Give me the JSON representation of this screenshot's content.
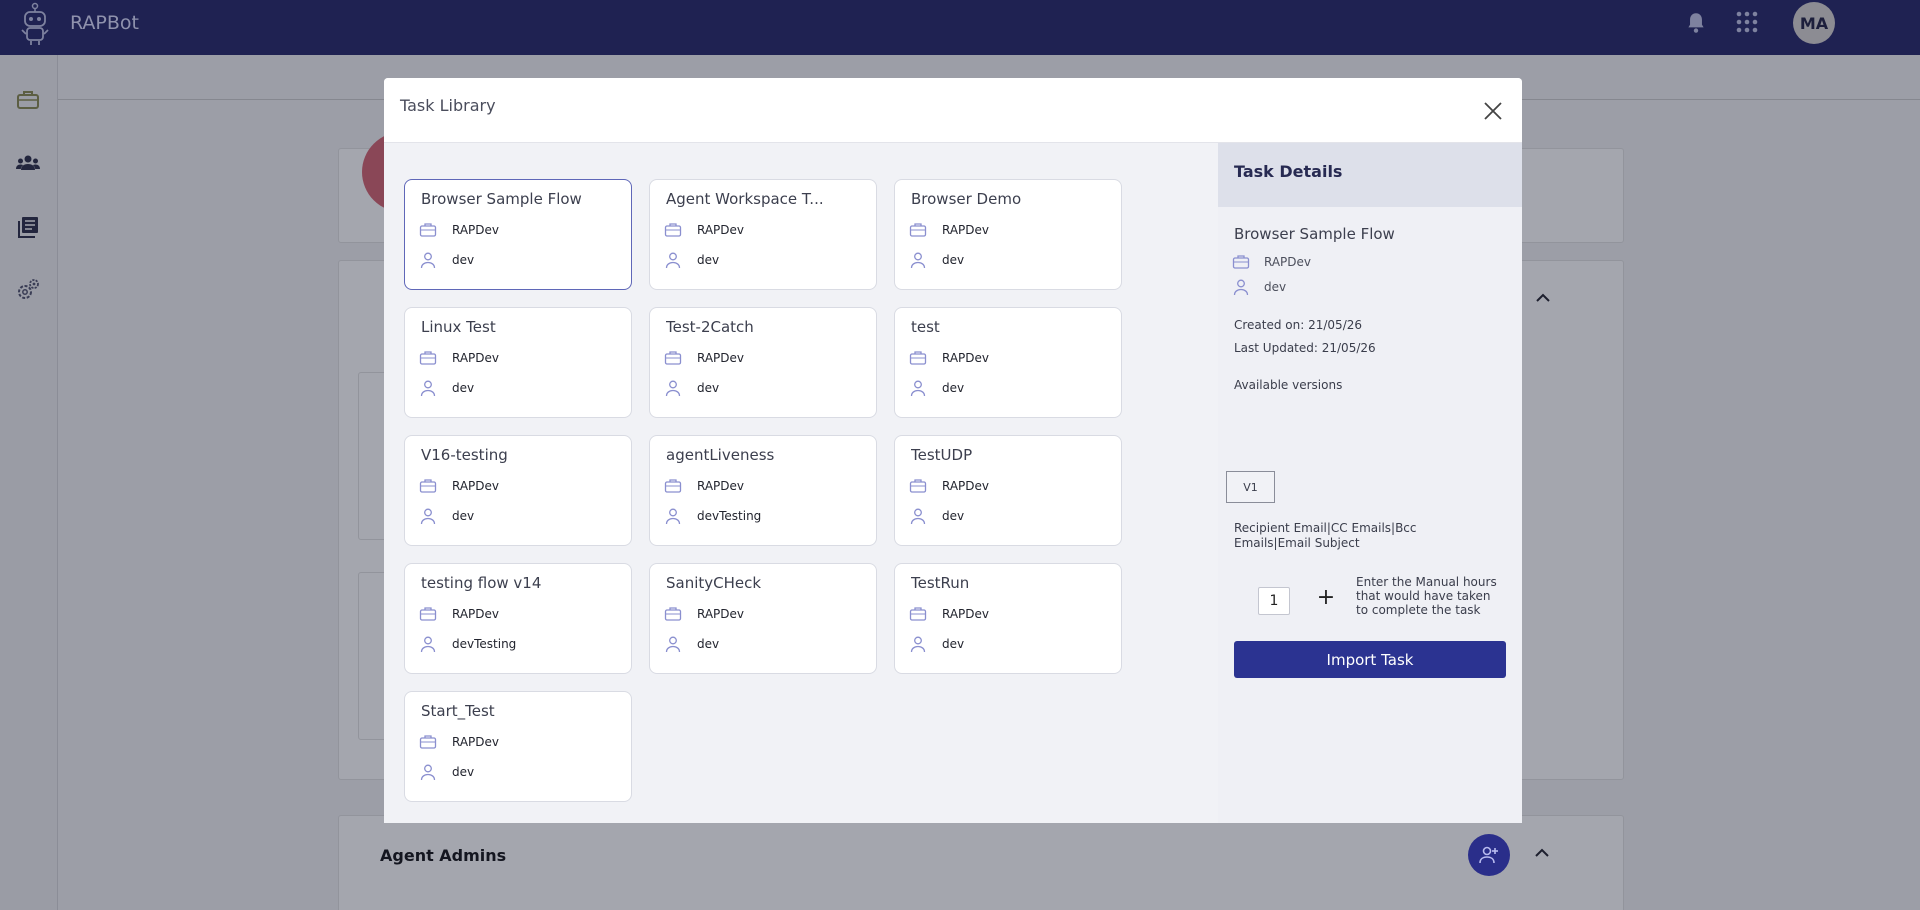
{
  "app": {
    "name": "RAPBot",
    "user_initials": "MA"
  },
  "background": {
    "section_title": "Agent Admins"
  },
  "modal": {
    "title": "Task Library",
    "tasks": [
      {
        "name": "Browser Sample Flow",
        "workspace": "RAPDev",
        "owner": "dev",
        "selected": true
      },
      {
        "name": "Agent Workspace T...",
        "workspace": "RAPDev",
        "owner": "dev"
      },
      {
        "name": "Browser Demo",
        "workspace": "RAPDev",
        "owner": "dev"
      },
      {
        "name": "Linux Test",
        "workspace": "RAPDev",
        "owner": "dev"
      },
      {
        "name": "Test-2Catch",
        "workspace": "RAPDev",
        "owner": "dev"
      },
      {
        "name": "test",
        "workspace": "RAPDev",
        "owner": "dev"
      },
      {
        "name": "V16-testing",
        "workspace": "RAPDev",
        "owner": "dev"
      },
      {
        "name": "agentLiveness",
        "workspace": "RAPDev",
        "owner": "devTesting"
      },
      {
        "name": "TestUDP",
        "workspace": "RAPDev",
        "owner": "dev"
      },
      {
        "name": "testing flow v14",
        "workspace": "RAPDev",
        "owner": "devTesting"
      },
      {
        "name": "SanityCHeck",
        "workspace": "RAPDev",
        "owner": "dev"
      },
      {
        "name": "TestRun",
        "workspace": "RAPDev",
        "owner": "dev"
      },
      {
        "name": "Start_Test",
        "workspace": "RAPDev",
        "owner": "dev"
      }
    ],
    "details": {
      "heading": "Task Details",
      "name": "Browser Sample Flow",
      "workspace": "RAPDev",
      "owner": "dev",
      "created": "Created on: 21/05/26",
      "updated": "Last Updated: 21/05/26",
      "versions_label": "Available versions",
      "versions": [
        "V1"
      ],
      "recipients": "Recipient Email|CC Emails|Bcc Emails|Email Subject",
      "manual_hours": "1",
      "plus_label": "+",
      "hours_hint": "Enter the Manual hours that would have taken to complete the task",
      "import_label": "Import Task"
    }
  },
  "colors": {
    "topbar": "#1f2252",
    "accent": "#2b3391",
    "icon": "#6f78c9"
  },
  "icons": [
    "robot-logo-icon",
    "bell-icon",
    "apps-grid-icon",
    "briefcase-icon",
    "users-icon",
    "library-icon",
    "settings-icon",
    "close-icon",
    "user-icon",
    "add-user-icon",
    "chevron-up-icon"
  ]
}
